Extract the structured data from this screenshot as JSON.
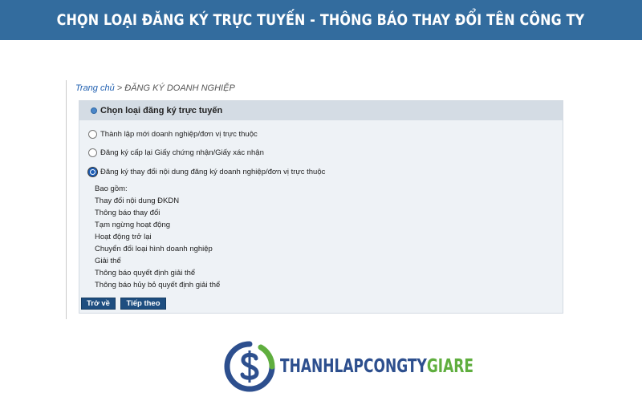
{
  "banner": {
    "title": "CHỌN LOẠI ĐĂNG KÝ TRỰC TUYẾN - THÔNG BÁO THAY ĐỔI TÊN CÔNG TY"
  },
  "breadcrumb": {
    "home": "Trang chủ",
    "separator": " > ",
    "current": "ĐĂNG KÝ DOANH NGHIỆP"
  },
  "panel": {
    "title": "Chọn loại đăng ký trực tuyến",
    "options": [
      {
        "label": "Thành lập mới doanh nghiệp/đơn vị trực thuộc",
        "checked": false
      },
      {
        "label": "Đăng ký cấp lại Giấy chứng nhận/Giấy xác nhận",
        "checked": false
      },
      {
        "label": "Đăng ký thay đổi nội dung đăng ký doanh nghiệp/đơn vị trực thuộc",
        "checked": true
      }
    ],
    "includes_label": "Bao gồm:",
    "includes": [
      "Thay đổi nội dung ĐKDN",
      "Thông báo thay đổi",
      "Tạm ngừng hoạt động",
      "Hoạt động trở lại",
      "Chuyển đổi loại hình doanh nghiệp",
      "Giải thể",
      "Thông báo quyết định giải thể",
      "Thông báo hủy bỏ quyết định giải thể"
    ],
    "back_button": "Trở về",
    "next_button": "Tiếp theo"
  },
  "logo": {
    "text_part1": "THANHLAPCONGTY",
    "text_part2": "GIARE"
  },
  "colors": {
    "banner": "#336c9e",
    "button": "#1e4e80",
    "link": "#1f5fb0",
    "logo_blue": "#2d4f8e",
    "logo_green": "#5fae3e"
  }
}
